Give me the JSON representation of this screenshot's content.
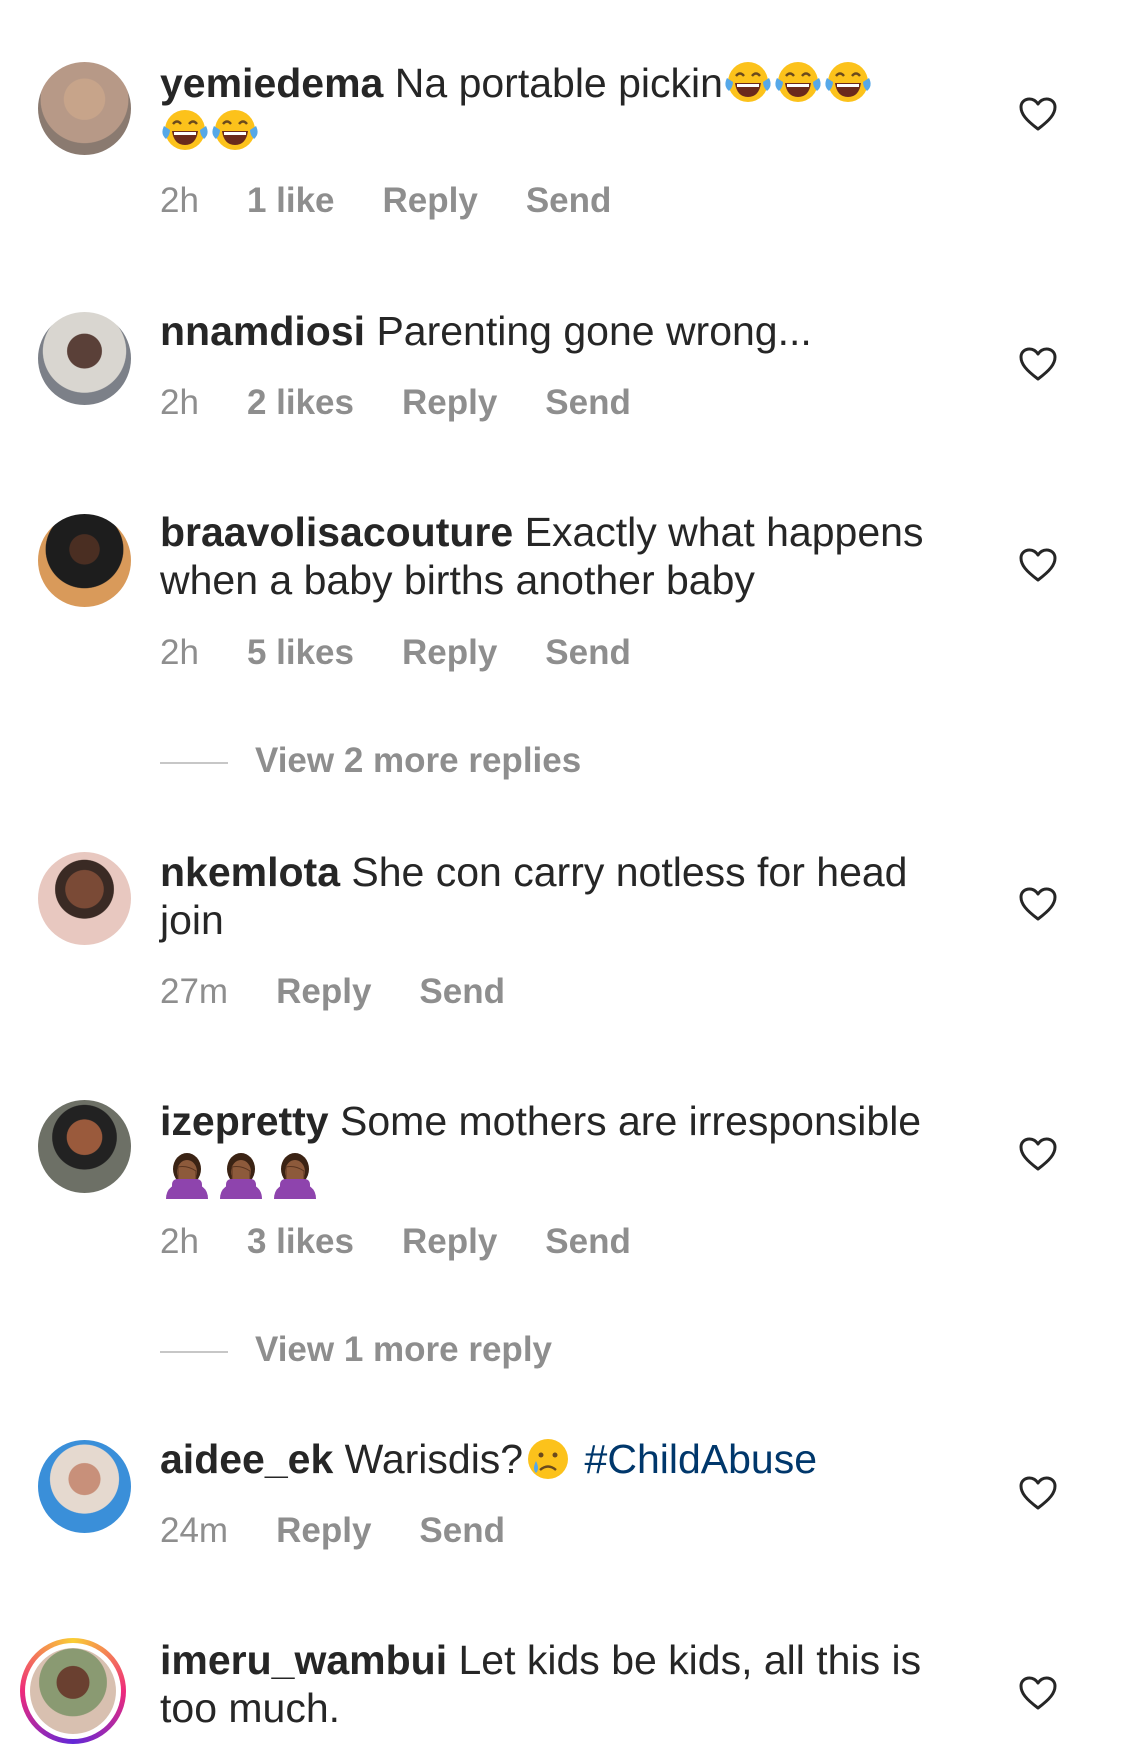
{
  "comments": [
    {
      "username": "yemiedema",
      "text": "Na portable pickin",
      "emoji": "😂😂😂😂😂",
      "time": "2h",
      "likes": "1 like",
      "reply": "Reply",
      "send": "Send"
    },
    {
      "username": "nnamdiosi",
      "text": "Parenting gone wrong...",
      "time": "2h",
      "likes": "2 likes",
      "reply": "Reply",
      "send": "Send"
    },
    {
      "username": "braavolisacouture",
      "text": "Exactly what happens when a baby births another baby",
      "time": "2h",
      "likes": "5 likes",
      "reply": "Reply",
      "send": "Send",
      "view_more": "View 2 more replies"
    },
    {
      "username": "nkemlota",
      "text": "She con carry notless for head join",
      "time": "27m",
      "reply": "Reply",
      "send": "Send"
    },
    {
      "username": "izepretty",
      "text": "Some mothers are irresponsible",
      "emoji": "🤦🏾‍♀️🤦🏾‍♀️🤦🏾‍♀️",
      "time": "2h",
      "likes": "3 likes",
      "reply": "Reply",
      "send": "Send",
      "view_more": "View 1 more reply"
    },
    {
      "username": "aidee_ek",
      "text": "Warisdis?",
      "emoji": "😢",
      "hashtag": "#ChildAbuse",
      "time": "24m",
      "reply": "Reply",
      "send": "Send"
    },
    {
      "username": "imeru_wambui",
      "text": "Let kids be kids, all this is too much."
    }
  ],
  "icons": {
    "like": "heart-outline-icon"
  },
  "colors": {
    "text": "#262626",
    "meta": "#8e8e8e",
    "hashtag": "#00376b"
  }
}
